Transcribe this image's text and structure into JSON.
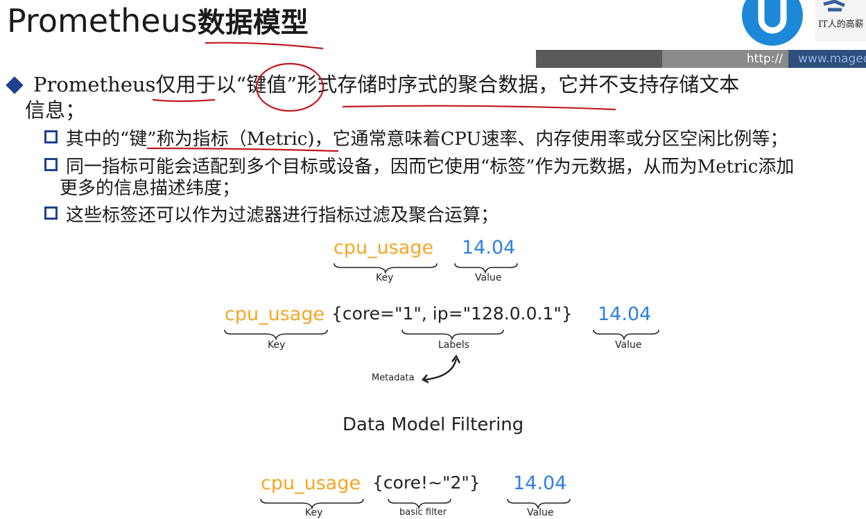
{
  "title": {
    "en": "Prometheus",
    "cn": "数据模型"
  },
  "brand": {
    "logo_text": "IT人的高薪"
  },
  "url_bar": {
    "http": "http://",
    "domain": "www.magedu"
  },
  "bullet": {
    "line1": "Prometheus仅用于以“键值”形式存储时序式的聚合数据，它并不支持存储文本",
    "line2": "信息；"
  },
  "subs": [
    {
      "text": "其中的“键”称为指标（Metric)，它通常意味着CPU速率、内存使用率或分区空闲比例等；"
    },
    {
      "text": "同一指标可能会适配到多个目标或设备，因而它使用“标签”作为元数据，从而为Metric添加",
      "cont": "更多的信息描述纬度；"
    },
    {
      "text": "这些标签还可以作为过滤器进行指标过滤及聚合运算；"
    }
  ],
  "diagram1": {
    "key": "cpu_usage",
    "value": "14.04",
    "key_label": "Key",
    "value_label": "Value"
  },
  "diagram2": {
    "key": "cpu_usage",
    "labels": "{core=\"1\", ip=\"128.0.0.1\"}",
    "value": "14.04",
    "key_label": "Key",
    "labels_label": "Labels",
    "value_label": "Value",
    "metadata_label": "Metadata"
  },
  "filter_heading": "Data Model Filtering",
  "diagram3": {
    "key": "cpu_usage",
    "filter": "{core!~\"2\"}",
    "value": "14.04",
    "key_label": "Key",
    "filter_label": "basic filter",
    "value_label": "Value"
  },
  "colors": {
    "key": "#f5a623",
    "value": "#2e7fe0",
    "annotation": "#c0191f",
    "accent": "#1f3f8f"
  }
}
